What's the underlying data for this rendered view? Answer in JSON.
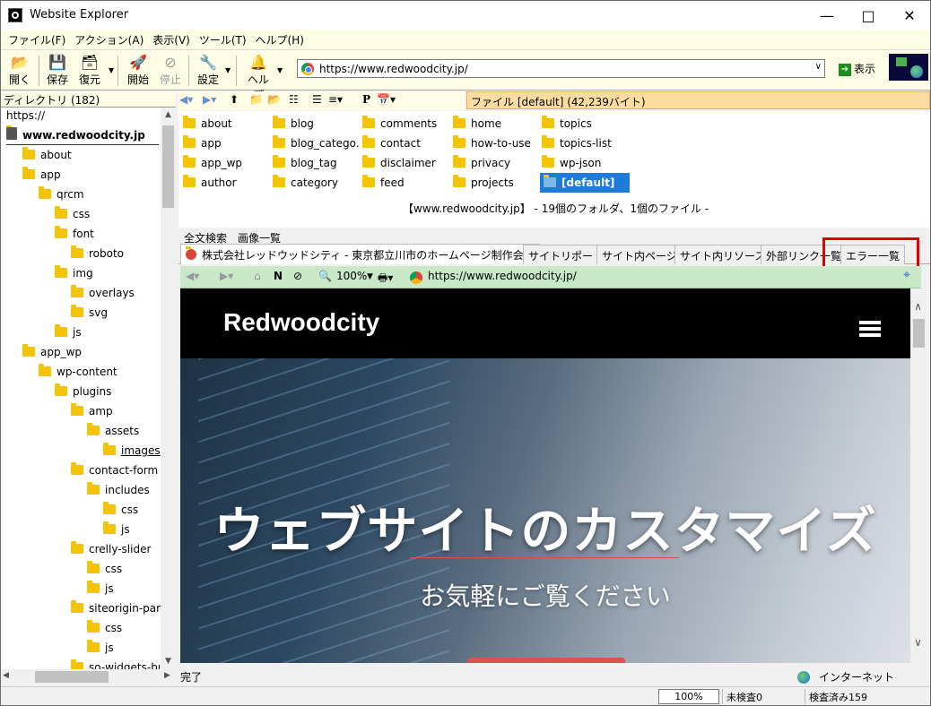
{
  "window": {
    "title": "Website Explorer"
  },
  "menu": [
    "ファイル(F)",
    "アクション(A)",
    "表示(V)",
    "ツール(T)",
    "ヘルプ(H)"
  ],
  "toolbar": {
    "open": "開く",
    "save": "保存",
    "restore": "復元",
    "start": "開始",
    "stop": "停止",
    "settings": "設定",
    "help": "ヘルプ",
    "address": "https://www.redwoodcity.jp/",
    "go": "表示"
  },
  "left": {
    "header": "ディレクトリ (182)",
    "address": "https://",
    "tree": [
      {
        "label": "www.redwoodcity.jp",
        "depth": 0,
        "root": true
      },
      {
        "label": "about",
        "depth": 1
      },
      {
        "label": "app",
        "depth": 1
      },
      {
        "label": "qrcm",
        "depth": 2
      },
      {
        "label": "css",
        "depth": 3
      },
      {
        "label": "font",
        "depth": 3
      },
      {
        "label": "roboto",
        "depth": 4
      },
      {
        "label": "img",
        "depth": 3
      },
      {
        "label": "overlays",
        "depth": 4
      },
      {
        "label": "svg",
        "depth": 4
      },
      {
        "label": "js",
        "depth": 3
      },
      {
        "label": "app_wp",
        "depth": 1
      },
      {
        "label": "wp-content",
        "depth": 2
      },
      {
        "label": "plugins",
        "depth": 3
      },
      {
        "label": "amp",
        "depth": 4
      },
      {
        "label": "assets",
        "depth": 5
      },
      {
        "label": "images",
        "depth": 6,
        "underline": true
      },
      {
        "label": "contact-form",
        "depth": 4
      },
      {
        "label": "includes",
        "depth": 5
      },
      {
        "label": "css",
        "depth": 6
      },
      {
        "label": "js",
        "depth": 6
      },
      {
        "label": "crelly-slider",
        "depth": 4
      },
      {
        "label": "css",
        "depth": 5
      },
      {
        "label": "js",
        "depth": 5
      },
      {
        "label": "siteorigin-pan",
        "depth": 4
      },
      {
        "label": "css",
        "depth": 5
      },
      {
        "label": "js",
        "depth": 5
      },
      {
        "label": "so-widgets-bu",
        "depth": 4
      }
    ]
  },
  "nav2": {
    "zoom": "100",
    "file_info": "ファイル [default] (42,239バイト)"
  },
  "folders": {
    "cols": [
      [
        "about",
        "app",
        "app_wp",
        "author"
      ],
      [
        "blog",
        "blog_catego...",
        "blog_tag",
        "category"
      ],
      [
        "comments",
        "contact",
        "disclaimer",
        "feed"
      ],
      [
        "home",
        "how-to-use",
        "privacy",
        "projects"
      ],
      [
        "topics",
        "topics-list",
        "wp-json"
      ]
    ],
    "selected": "[default]",
    "summary": "【www.redwoodcity.jp】 - 19個のフォルダ、1個のファイル -"
  },
  "subtabs": [
    "全文検索",
    "画像一覧"
  ],
  "tabs": [
    "株式会社レッドウッドシティ - 東京都立川市のホームページ制作会社",
    "サイトリポート",
    "サイト内ページ",
    "サイト内リソース",
    "外部リンク一覧",
    "エラー一覧"
  ],
  "browser_toolbar": {
    "zoom": "100%",
    "url": "https://www.redwoodcity.jp/"
  },
  "page": {
    "logo": "Redwoodcity",
    "hero_title": "ウェブサイトのカスタマイズ",
    "hero_subtitle": "お気軽にご覧ください"
  },
  "status": {
    "left": "完了",
    "zone": "インターネット"
  },
  "bottom": {
    "zoom": "100%",
    "unchecked": "未検査0",
    "checked": "検査済み159"
  },
  "colors": {
    "selection": "#1e7bd8",
    "highlight_box": "#e30000",
    "file_bar": "#fcdca0",
    "browser_toolbar": "#c8e8c8"
  }
}
